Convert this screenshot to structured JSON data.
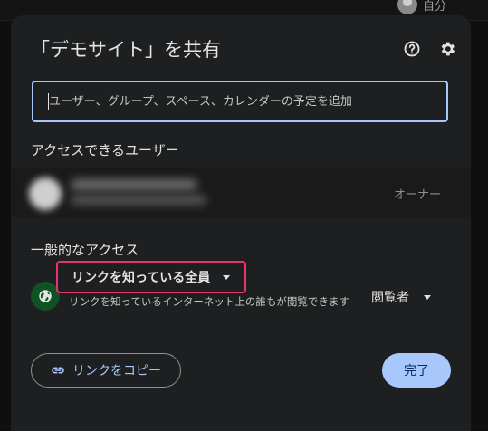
{
  "background": {
    "user_label": "自分"
  },
  "dialog": {
    "title": "「デモサイト」を共有",
    "help_icon": "help-circle-icon",
    "settings_icon": "gear-icon",
    "search": {
      "placeholder": "ユーザー、グループ、スペース、カレンダーの予定を追加",
      "value": ""
    },
    "people_heading": "アクセスできるユーザー",
    "owner_role": "オーナー",
    "general_heading": "一般的なアクセス",
    "general_access": {
      "option": "リンクを知っている全員",
      "description": "リンクを知っているインターネット上の誰もが閲覧できます",
      "role": "閲覧者"
    },
    "copy_link_label": "リンクをコピー",
    "done_label": "完了"
  },
  "colors": {
    "accent": "#a8c7fa",
    "highlight_border": "#e8336f",
    "globe_bg": "#0f5223",
    "dialog_bg": "#1e1f20"
  }
}
